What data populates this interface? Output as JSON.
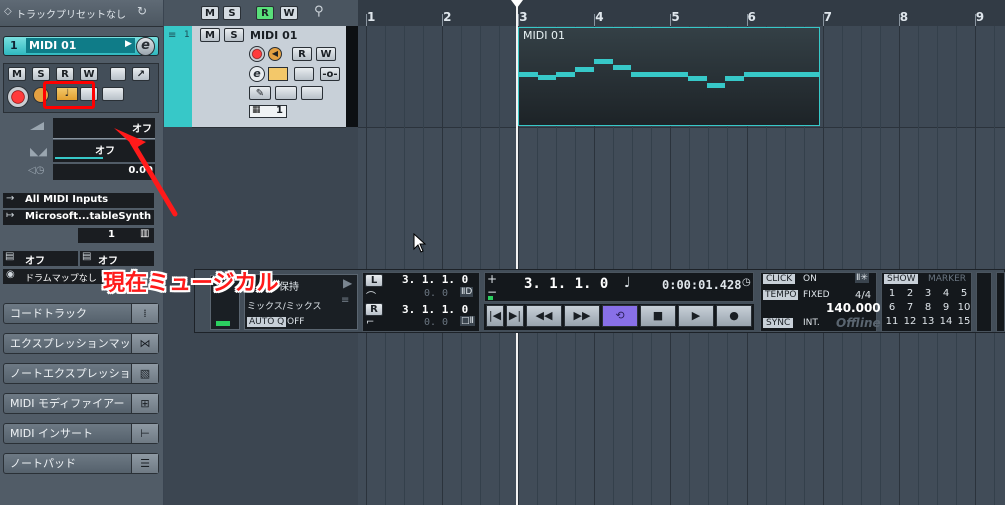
{
  "inspector": {
    "preset_label": "トラックプリセットなし",
    "track_number": "1",
    "track_name": "MIDI 01",
    "e_label": "e",
    "btn_m": "M",
    "btn_s": "S",
    "btn_r": "R",
    "btn_w": "W",
    "volume_value": "オフ",
    "pan_value": "オフ",
    "delay_value": "0.00",
    "midi_input": "All MIDI Inputs",
    "midi_output": "Microsoft...tableSynth",
    "channel": "1",
    "bank_value": "オフ",
    "program_value": "オフ",
    "drum_map": "ドラムマップなし",
    "sections": [
      {
        "label": "コードトラック",
        "icon": "chord-icon"
      },
      {
        "label": "エクスプレッションマップ",
        "icon": "expression-map-icon"
      },
      {
        "label": "ノートエクスプレッション",
        "icon": "note-expression-icon"
      },
      {
        "label": "MIDI モディファイアー",
        "icon": "midi-modifier-icon"
      },
      {
        "label": "MIDI インサート",
        "icon": "midi-insert-icon"
      },
      {
        "label": "ノートパッド",
        "icon": "notepad-icon"
      }
    ]
  },
  "toolbar": {
    "m_label": "M",
    "s_label": "S",
    "r_label": "R",
    "w_label": "W"
  },
  "tracklist": {
    "track_number": "1",
    "track_name": "MIDI 01",
    "m_label": "M",
    "s_label": "S",
    "r_label": "R",
    "w_label": "W",
    "e_label": "e",
    "channel": "1"
  },
  "ruler": {
    "bars": [
      "1",
      "2",
      "3",
      "4",
      "5",
      "6",
      "7",
      "8",
      "9"
    ]
  },
  "part": {
    "name": "MIDI 01"
  },
  "annotation": {
    "text": "現在ミュージカル",
    "highlight_color": "#ff0000"
  },
  "transport": {
    "mode_line1": "保持",
    "mode_line2": "ミックス/ミックス",
    "auto_q_label": "AUTO Q",
    "auto_q_value": "OFF",
    "left_label": "L",
    "left_locator": "3. 1. 1.   0",
    "left_offset": "0.   0",
    "right_label": "R",
    "right_locator": "3. 1. 1.   0",
    "right_offset": "0.   0",
    "position_bars": "3.  1.  1.   0",
    "position_time": "0:00:01.428",
    "click_label": "CLICK",
    "click_value": "ON",
    "tempo_label": "TEMPO",
    "tempo_mode": "FIXED",
    "signature": "4/4",
    "tempo_value": "140.000",
    "sync_label": "SYNC",
    "sync_value": "INT.",
    "sync_status": "Offline",
    "show_label": "SHOW",
    "marker_label": "MARKER",
    "marker_numbers": [
      "1",
      "2",
      "3",
      "4",
      "5",
      "6",
      "7",
      "8",
      "9",
      "10",
      "11",
      "12",
      "13",
      "14",
      "15"
    ]
  },
  "colors": {
    "accent": "#37c8c8",
    "loop_active": "#8870e8"
  }
}
